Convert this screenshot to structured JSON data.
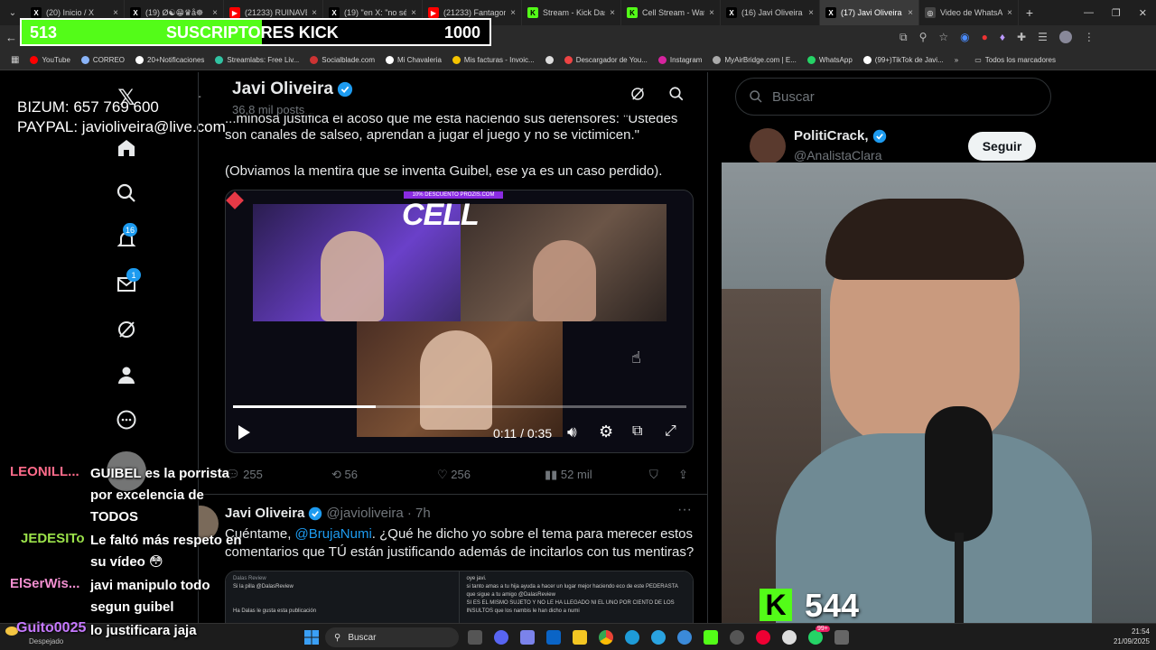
{
  "browser": {
    "tabs": [
      {
        "label": "(20) Inicio / X",
        "icon": "x-logo-icon",
        "color": "#000000"
      },
      {
        "label": "(19) Ø☯😁♛å☸",
        "icon": "x-logo-icon",
        "color": "#000000"
      },
      {
        "label": "(21233) RUINAVE",
        "icon": "youtube-icon",
        "color": "#ff0000"
      },
      {
        "label": "(19) \"en X: \"no sé",
        "icon": "x-logo-icon",
        "color": "#000000"
      },
      {
        "label": "(21233) Fantagon",
        "icon": "youtube-icon",
        "color": "#ff0000"
      },
      {
        "label": "Stream - Kick Das",
        "icon": "kick-icon",
        "color": "#53fc18"
      },
      {
        "label": "Cell Stream - Wat",
        "icon": "kick-icon",
        "color": "#53fc18"
      },
      {
        "label": "(16) Javi Oliveira",
        "icon": "x-logo-icon",
        "color": "#000000"
      },
      {
        "label": "(17) Javi Oliveira",
        "icon": "x-logo-icon",
        "color": "#000000",
        "active": true
      },
      {
        "label": "Video de WhatsAp",
        "icon": "globe-icon",
        "color": "#444444"
      }
    ],
    "bookmarks": [
      "YouTube",
      "CORREO",
      "20+Notificaciones",
      "Streamlabs: Free Liv...",
      "Socialblade.com",
      "Mi Chavaleria",
      "Mis facturas - Invoic...",
      "Descargador de You...",
      "Instagram",
      "MyAirBridge.com | E...",
      "WhatsApp",
      "(99+)TikTok de Javi..."
    ],
    "bookmarks_folder": "Todos los marcadores"
  },
  "overlay": {
    "sub_current": "513",
    "sub_title": "SUSCRIPTORES KICK",
    "sub_goal": "1000",
    "sub_progress": 0.513,
    "bizum": "BIZUM: 657 769 600",
    "paypal": "PAYPAL: javioliveira@live.com",
    "viewer_count": "544"
  },
  "profile": {
    "name": "Javi Oliveira",
    "posts": "36,8 mil posts"
  },
  "nav": {
    "notif_badge": "16",
    "msg_badge": "1"
  },
  "post1": {
    "line0": "...minosa justifica el acoso que me está haciendo sus defensores: \"Ustedes",
    "line1": "son canales de salseo, aprendan a jugar el juego y no se victimicen.\"",
    "line2": "(Obviamos la mentira que se inventa Guibel, ese ya es un caso perdido).",
    "video_banner": "10% DESCUENTO PROZIS.COM",
    "video_title": "CELL",
    "video_time": "0:11 / 0:35",
    "video_progress": 0.314,
    "replies": "255",
    "reposts": "56",
    "likes": "256",
    "views": "52 mil"
  },
  "post2": {
    "author": "Javi Oliveira",
    "handle": "@javioliveira · 7h",
    "text_a": "Cuéntame, ",
    "mention": "@BrujaNumi",
    "text_b": ". ¿Qué he dicho yo sobre el tema para merecer estos comentarios que TÚ están justificando además de incitarlos con tus mentiras?",
    "quoted_left_1": "Dalas Review",
    "quoted_left_2": "Si la pilla @DalasReview",
    "quoted_left_3": "Ha Dalas le gusta esta publicación",
    "quoted_right_1": "oye javi.",
    "quoted_right_2": "si tanto amas a tu hija ayuda a hacer un lugar mejor haciendo eco de este PEDERASTA que sigue a tu amigo @DalasReview",
    "quoted_right_3": "SI ES EL MISMO SUJETO Y NO LE HA LLEGADO NI EL UNO POR CIENTO DE LOS INSULTOS que los nambis le han dicho a numi"
  },
  "right": {
    "search_placeholder": "Buscar",
    "suggest_name": "PolitiCrack,",
    "suggest_handle": "@AnalistaClara",
    "follow_label": "Seguir"
  },
  "chat": [
    {
      "user": "LEONILL...",
      "color": "#ff6b8a",
      "lines": [
        "GUIBEL es la porrista",
        "por excelencia de",
        "TODOS"
      ]
    },
    {
      "user": "JEDESITo",
      "color": "#9be24a",
      "lines": [
        "Le faltó más respeto en",
        "su vídeo 😳"
      ]
    },
    {
      "user": "ElSerWis...",
      "color": "#f28fd0",
      "lines": [
        "javi manipulo todo",
        "segun guibel"
      ]
    },
    {
      "user": "Guito0025",
      "color": "#c679ff",
      "lines": [
        "lo justificara jaja"
      ]
    }
  ],
  "taskbar": {
    "search": "Buscar",
    "weather": "Despejado",
    "time": "21:54",
    "date": "21/09/2025",
    "whatsapp_badge": "99+"
  }
}
